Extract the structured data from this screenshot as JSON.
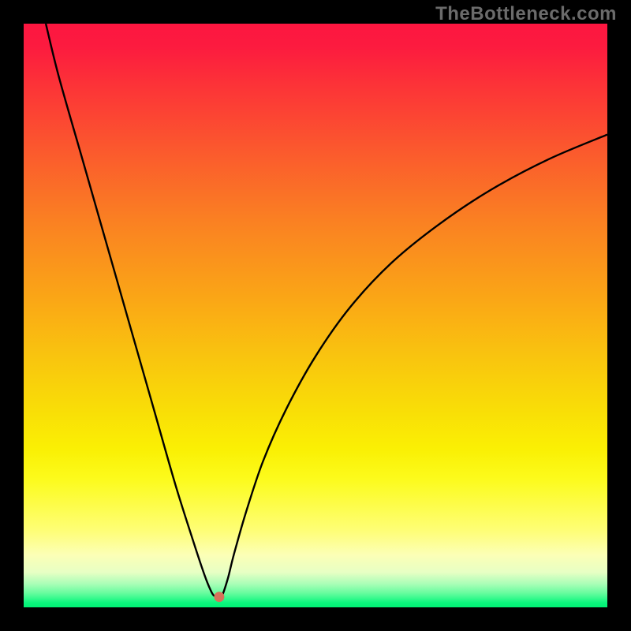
{
  "watermark": "TheBottleneck.com",
  "chart_data": {
    "type": "line",
    "title": "",
    "xlabel": "",
    "ylabel": "",
    "xlim": [
      0,
      100
    ],
    "ylim": [
      0,
      100
    ],
    "series": [
      {
        "name": "curve",
        "xy": [
          [
            3.8,
            100.0
          ],
          [
            6.0,
            91.0
          ],
          [
            10.0,
            77.0
          ],
          [
            14.0,
            63.0
          ],
          [
            18.0,
            49.0
          ],
          [
            22.0,
            35.0
          ],
          [
            26.0,
            21.0
          ],
          [
            29.0,
            11.5
          ],
          [
            31.0,
            5.5
          ],
          [
            32.0,
            3.0
          ],
          [
            32.6,
            2.0
          ],
          [
            33.5,
            1.8
          ],
          [
            34.0,
            2.0
          ],
          [
            35.0,
            5.0
          ],
          [
            36.0,
            9.0
          ],
          [
            38.0,
            16.0
          ],
          [
            41.0,
            25.0
          ],
          [
            45.0,
            34.0
          ],
          [
            50.0,
            43.0
          ],
          [
            56.0,
            51.5
          ],
          [
            63.0,
            59.0
          ],
          [
            71.0,
            65.5
          ],
          [
            80.0,
            71.5
          ],
          [
            90.0,
            76.8
          ],
          [
            100.0,
            81.0
          ]
        ]
      }
    ],
    "marker": {
      "name": "min-point",
      "x": 33.5,
      "y": 1.8
    },
    "gradient_stops": [
      {
        "pos": 0.0,
        "color": "#fd1640"
      },
      {
        "pos": 0.04,
        "color": "#fc1b3f"
      },
      {
        "pos": 0.1,
        "color": "#fc3138"
      },
      {
        "pos": 0.22,
        "color": "#fb5a2d"
      },
      {
        "pos": 0.34,
        "color": "#fa8122"
      },
      {
        "pos": 0.47,
        "color": "#faa616"
      },
      {
        "pos": 0.58,
        "color": "#f9c70e"
      },
      {
        "pos": 0.67,
        "color": "#f9e006"
      },
      {
        "pos": 0.73,
        "color": "#faf004"
      },
      {
        "pos": 0.78,
        "color": "#fcfb1c"
      },
      {
        "pos": 0.87,
        "color": "#fefe78"
      },
      {
        "pos": 0.91,
        "color": "#fcffb6"
      },
      {
        "pos": 0.94,
        "color": "#e7ffc4"
      },
      {
        "pos": 0.96,
        "color": "#a9feb7"
      },
      {
        "pos": 0.975,
        "color": "#6afc9f"
      },
      {
        "pos": 0.985,
        "color": "#34f98c"
      },
      {
        "pos": 0.992,
        "color": "#0bf67d"
      },
      {
        "pos": 1.0,
        "color": "#01f175"
      }
    ]
  }
}
